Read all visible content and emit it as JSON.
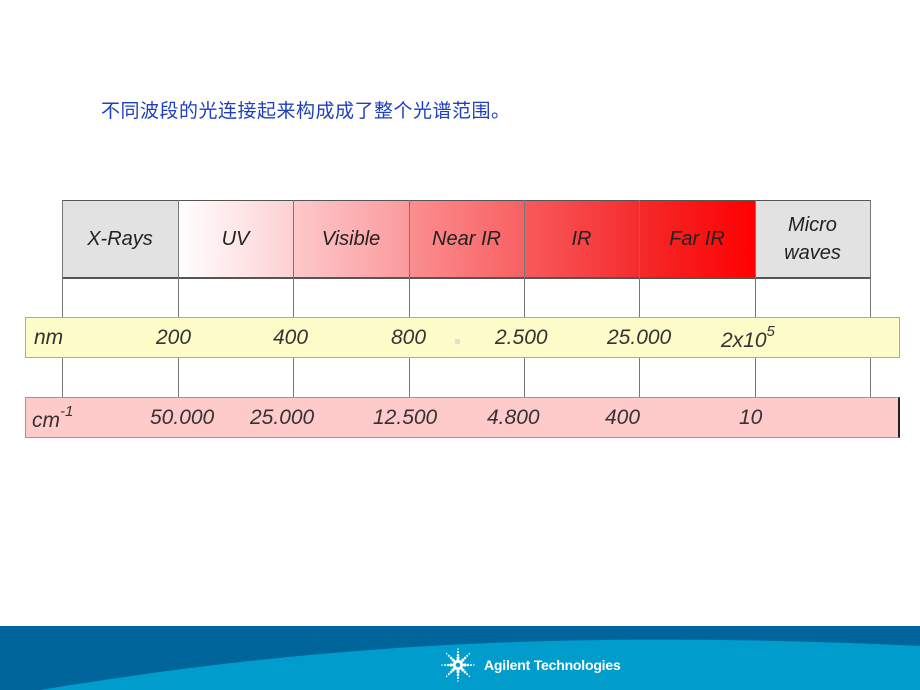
{
  "title": "不同波段的光连接起来构成成了整个光谱范围。",
  "regions": [
    {
      "label": "X-Rays",
      "fill": "#e2e2e2"
    },
    {
      "label": "UV",
      "gradient": [
        "#ffffff",
        "#fdd0d3"
      ]
    },
    {
      "label": "Visible",
      "gradient": [
        "#fdc9cc",
        "#fb9a9c"
      ]
    },
    {
      "label": "Near IR",
      "gradient": [
        "#fa8f91",
        "#f96062"
      ]
    },
    {
      "label": "IR",
      "gradient": [
        "#f85a5c",
        "#f52c2e"
      ]
    },
    {
      "label": "Far IR",
      "gradient": [
        "#f42a2b",
        "#ff0000"
      ]
    },
    {
      "label": "Micro\nwaves",
      "fill": "#e2e2e2"
    }
  ],
  "wavelength_scale": {
    "unit": "nm",
    "values": [
      "200",
      "400",
      "800",
      "2.500",
      "25.000"
    ],
    "last": {
      "base": "2x10",
      "exponent": "5"
    },
    "color": "#fefcc8"
  },
  "wavenumber_scale": {
    "unit_base": "cm",
    "unit_exponent": "-1",
    "values": [
      "50.000",
      "25.000",
      "12.500",
      "4.800",
      "400",
      "10"
    ],
    "color": "#fecaca"
  },
  "footer": {
    "brand": "Agilent Technologies",
    "dark_color": "#00659a",
    "light_color": "#009ccc"
  }
}
